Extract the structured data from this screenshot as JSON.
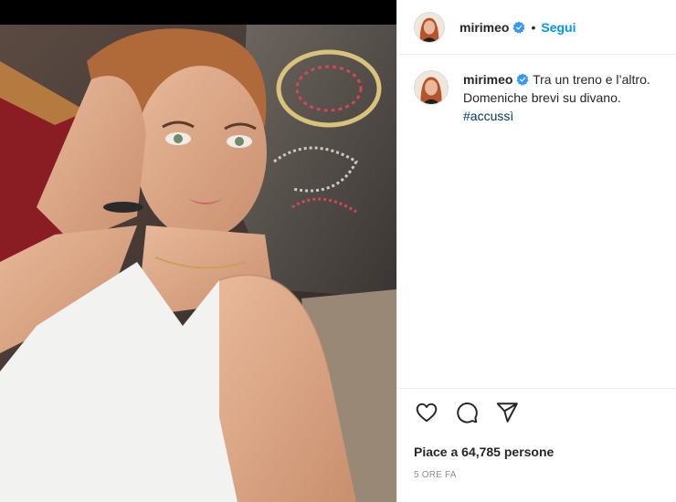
{
  "post": {
    "username": "mirimeo",
    "separator": "•",
    "follow_label": "Segui",
    "caption_line1": "Tra un treno e l’altro.",
    "caption_line2": "Domeniche brevi su divano.",
    "hashtag": "#accussì",
    "likes_text": "Piace a 64,785 persone",
    "timestamp": "5 ORE FA"
  },
  "icons": {
    "verified": "verified-badge-icon",
    "like": "heart-icon",
    "comment": "comment-bubble-icon",
    "share": "paper-plane-icon"
  },
  "colors": {
    "accent": "#0095f6",
    "verified": "#3897f0",
    "hashtag": "#00376b",
    "muted": "#8e8e8e"
  }
}
